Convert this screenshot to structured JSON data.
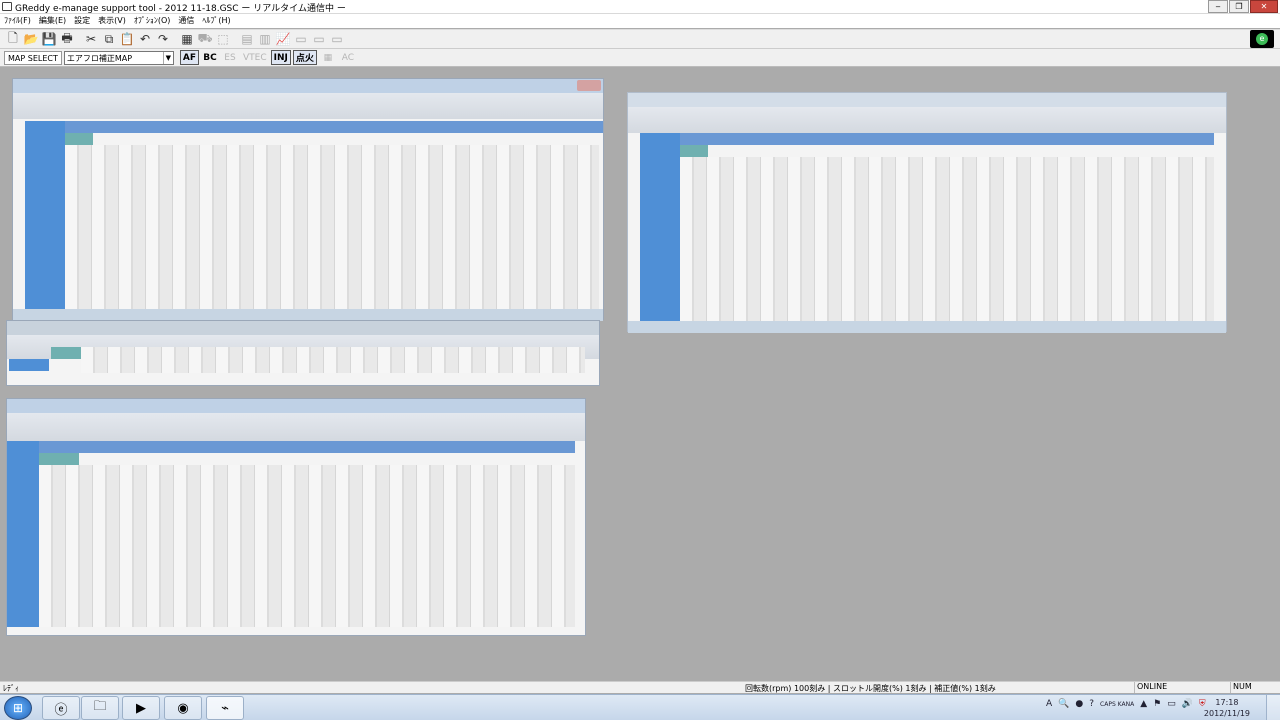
{
  "window": {
    "title": "GReddy e-manage support tool  - 2012 11-18.GSC       ー リアルタイム通信中 ー",
    "minimize_glyph": "‒",
    "restore_glyph": "❐",
    "close_glyph": "✕"
  },
  "menu": {
    "items": [
      "ﾌｧｲﾙ(F)",
      "編集(E)",
      "設定",
      "表示(V)",
      "ｵﾌﾟｼｮﾝ(O)",
      "通信",
      "ﾍﾙﾌﾟ(H)"
    ]
  },
  "toolbar": {
    "icons": [
      {
        "name": "new-icon",
        "glyph": "🗋"
      },
      {
        "name": "open-icon",
        "glyph": "📂"
      },
      {
        "name": "save-icon",
        "glyph": "💾"
      },
      {
        "name": "print-icon",
        "glyph": "🖶"
      },
      {
        "name": "cut-icon",
        "glyph": "✂"
      },
      {
        "name": "copy-icon",
        "glyph": "⧉"
      },
      {
        "name": "paste-icon",
        "glyph": "📋"
      },
      {
        "name": "undo-icon",
        "glyph": "↶"
      },
      {
        "name": "redo-icon",
        "glyph": "↷"
      },
      {
        "name": "table-icon",
        "glyph": "▦"
      },
      {
        "name": "car-icon",
        "glyph": "⛟"
      },
      {
        "name": "select-icon",
        "glyph": "⬚"
      },
      {
        "name": "map-left-icon",
        "glyph": "▤"
      },
      {
        "name": "map-right-icon",
        "glyph": "▥"
      },
      {
        "name": "graph-icon",
        "glyph": "📈"
      },
      {
        "name": "window-1-icon",
        "glyph": "▭"
      },
      {
        "name": "window-2-icon",
        "glyph": "▭"
      },
      {
        "name": "window-3-icon",
        "glyph": "▭"
      }
    ],
    "logo_glyph": "e"
  },
  "map_toolbar": {
    "label": "MAP SELECT",
    "selected": "エアフロ補正MAP",
    "modes": [
      {
        "label": "AF",
        "state": "active"
      },
      {
        "label": "BC",
        "state": "normal"
      },
      {
        "label": "ES",
        "state": "dim"
      },
      {
        "label": "VTEC",
        "state": "dim"
      },
      {
        "label": "INJ",
        "state": "active"
      },
      {
        "label": "点火",
        "state": "active"
      },
      {
        "label": "▦",
        "state": "dim"
      },
      {
        "label": "AC",
        "state": "dim"
      }
    ]
  },
  "status": {
    "ready": "ﾚﾃﾞｨ",
    "units": "回転数(rpm) 100刻み | スロットル開度(%) 1刻み | 補正値(%) 1刻み",
    "connection": "ONLINE",
    "numlock": "NUM"
  },
  "taskbar": {
    "start_glyph": "⊞",
    "apps": [
      {
        "name": "ie-icon",
        "glyph": "ⓔ"
      },
      {
        "name": "explorer-icon",
        "glyph": "🗀"
      },
      {
        "name": "media-player-icon",
        "glyph": "▶"
      },
      {
        "name": "chrome-icon",
        "glyph": "◉"
      },
      {
        "name": "emanage-icon",
        "glyph": "⌁"
      }
    ],
    "tray": [
      "A",
      "🔍",
      "●",
      "?",
      "CAPS KANA",
      "▲",
      "⚑",
      "▭",
      "🔊",
      "⛨"
    ],
    "time": "17:18",
    "date": "2012/11/19"
  }
}
